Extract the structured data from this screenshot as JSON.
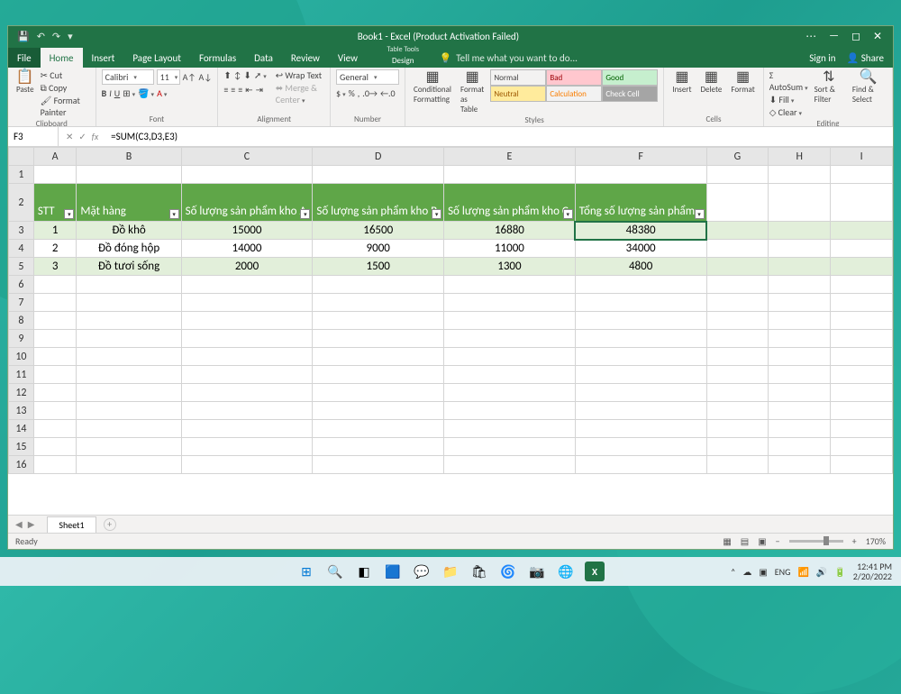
{
  "window": {
    "title": "Book1 - Excel (Product Activation Failed)",
    "signin": "Sign in",
    "share": "Share"
  },
  "tabs": {
    "file": "File",
    "list": [
      "Home",
      "Insert",
      "Page Layout",
      "Formulas",
      "Data",
      "Review",
      "View"
    ],
    "active": "Home",
    "context_group": "Table Tools",
    "context_tab": "Design",
    "tell": "Tell me what you want to do..."
  },
  "ribbon": {
    "clipboard": {
      "label": "Clipboard",
      "cut": "Cut",
      "copy": "Copy",
      "painter": "Format Painter",
      "paste": "Paste"
    },
    "font": {
      "label": "Font",
      "name": "Calibri",
      "size": "11"
    },
    "alignment": {
      "label": "Alignment",
      "wrap": "Wrap Text",
      "merge": "Merge & Center"
    },
    "number": {
      "label": "Number",
      "format": "General"
    },
    "styles": {
      "label": "Styles",
      "cond": "Conditional Formatting",
      "fmt": "Format as Table",
      "normal": "Normal",
      "bad": "Bad",
      "good": "Good",
      "neutral": "Neutral",
      "calc": "Calculation",
      "check": "Check Cell"
    },
    "cells": {
      "label": "Cells",
      "insert": "Insert",
      "delete": "Delete",
      "format": "Format"
    },
    "editing": {
      "label": "Editing",
      "autosum": "AutoSum",
      "fill": "Fill",
      "clear": "Clear",
      "sort": "Sort & Filter",
      "find": "Find & Select"
    }
  },
  "formulabar": {
    "cellref": "F3",
    "formula": "=SUM(C3,D3,E3)"
  },
  "grid": {
    "columns": [
      "A",
      "B",
      "C",
      "D",
      "E",
      "F",
      "G",
      "H",
      "I"
    ],
    "headerRow": 2,
    "headers": [
      "STT",
      "Mặt hàng",
      "Số lượng sản phẩm kho A",
      "Số lượng sản phẩm kho B",
      "Số lượng sản phẩm kho C",
      "Tổng số lượng sản phẩm"
    ],
    "rows": [
      {
        "r": 3,
        "band": 1,
        "cells": [
          "1",
          "Đồ khô",
          "15000",
          "16500",
          "16880",
          "48380"
        ]
      },
      {
        "r": 4,
        "band": 0,
        "cells": [
          "2",
          "Đồ đóng hộp",
          "14000",
          "9000",
          "11000",
          "34000"
        ]
      },
      {
        "r": 5,
        "band": 1,
        "cells": [
          "3",
          "Đồ tươi sống",
          "2000",
          "1500",
          "1300",
          "4800"
        ]
      }
    ],
    "selected": {
      "row": 3,
      "col": "F"
    }
  },
  "sheetbar": {
    "sheet": "Sheet1"
  },
  "statusbar": {
    "ready": "Ready",
    "zoom": "170%"
  },
  "taskbar": {
    "lang": "ENG",
    "time": "12:41 PM",
    "date": "2/20/2022"
  }
}
